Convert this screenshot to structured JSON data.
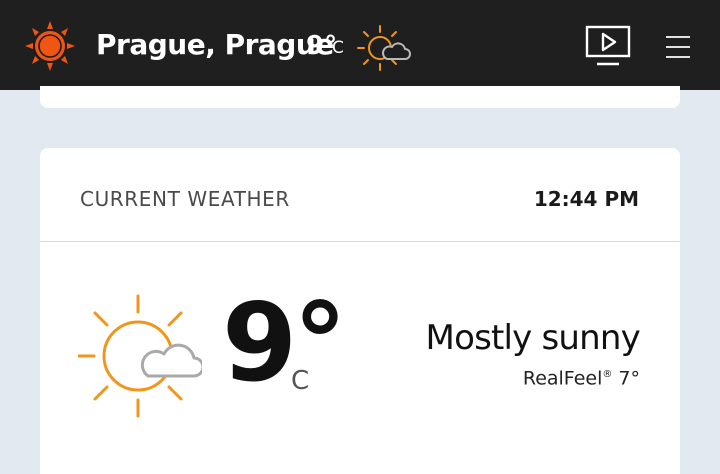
{
  "header": {
    "location": "Prague, Prague",
    "temperature": "9°",
    "unit": "C",
    "weather_icon": "partly-sunny-icon",
    "logo_icon": "sun-logo-icon",
    "video_icon": "video-icon",
    "menu_icon": "hamburger-menu-icon"
  },
  "current_weather": {
    "title": "CURRENT WEATHER",
    "time": "12:44 PM",
    "temperature": "9°",
    "unit": "C",
    "phrase": "Mostly sunny",
    "realfeel_label": "RealFeel",
    "realfeel_mark": "®",
    "realfeel_value": "7°",
    "icon": "mostly-sunny-icon"
  },
  "colors": {
    "header_bg": "#1f1f1f",
    "page_bg": "#e3e9f1",
    "accent_orange": "#f0961e",
    "logo_orange": "#f05514"
  }
}
